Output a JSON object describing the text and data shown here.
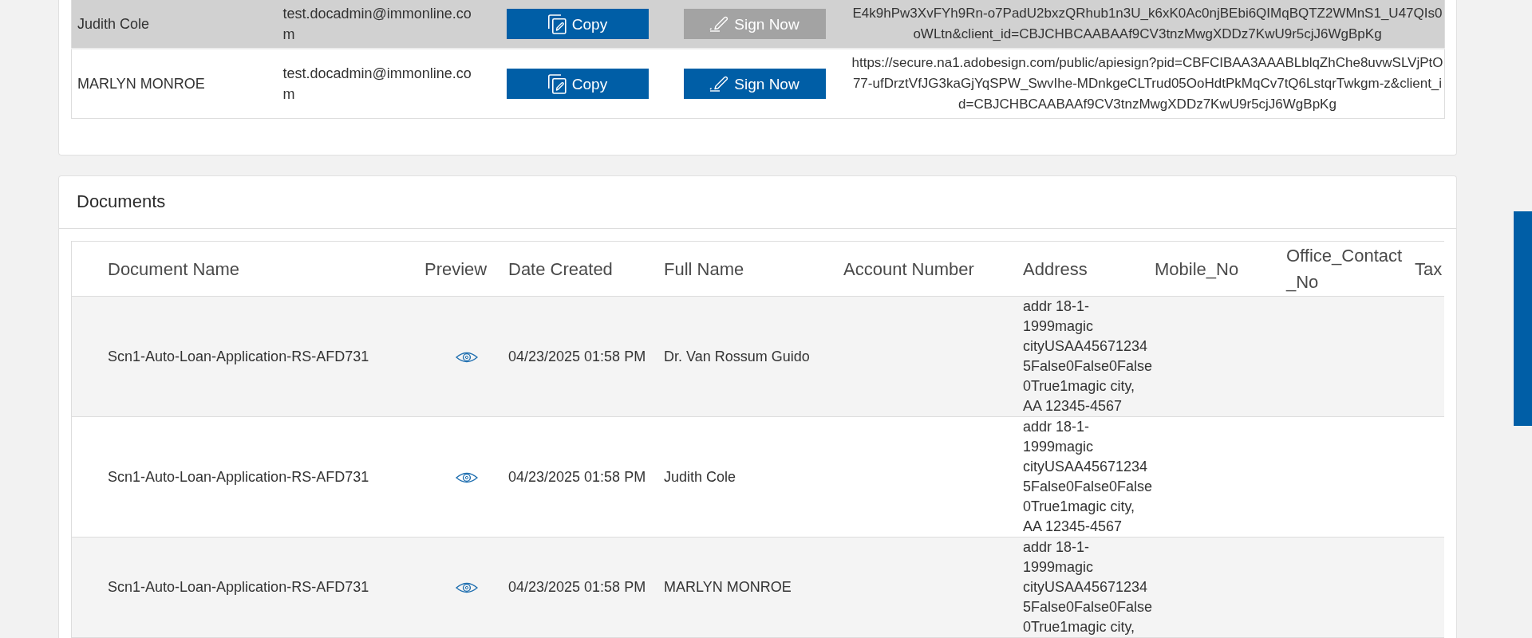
{
  "signers_table": {
    "rows": [
      {
        "name": "Judith Cole",
        "email": "test.docadmin@immonline.com",
        "highlighted": true,
        "copy_button": "Copy",
        "sign_button": {
          "label": "Sign Now",
          "disabled": true
        },
        "signing_url": "E4k9hPw3XvFYh9Rn-o7PadU2bxzQRhub1n3U_k6xK0Ac0njBEbi6QIMqBQTZ2WMnS1_U47QIs0oWLtn&client_id=CBJCHBCAABAAf9CV3tnzMwgXDDz7KwU9r5cjJ6WgBpKg"
      },
      {
        "name": "MARLYN MONROE",
        "email": "test.docadmin@immonline.com",
        "highlighted": false,
        "copy_button": "Copy",
        "sign_button": {
          "label": "Sign Now",
          "disabled": false
        },
        "signing_url": "https://secure.na1.adobesign.com/public/apiesign?pid=CBFCIBAA3AAABLblqZhChe8uvwSLVjPtO77-ufDrztVfJG3kaGjYqSPW_SwvIhe-MDnkgeCLTrud05OoHdtPkMqCv7tQ6LstqrTwkgm-z&client_id=CBJCHBCAABAAf9CV3tnzMwgXDDz7KwU9r5cjJ6WgBpKg"
      }
    ]
  },
  "documents": {
    "title": "Documents",
    "columns": [
      "Document Name",
      "Preview",
      "Date Created",
      "Full Name",
      "Account Number",
      "Address",
      "Mobile_No",
      "Office_Contact_No",
      "Tax"
    ],
    "rows": [
      {
        "document_name": "Scn1-Auto-Loan-Application-RS-AFD731",
        "date_created": "04/23/2025 01:58 PM",
        "full_name": "Dr. Van Rossum Guido",
        "address": "addr 18-1-1999magic cityUSAA456712345False0False0False0True1magic city, AA 12345-4567"
      },
      {
        "document_name": "Scn1-Auto-Loan-Application-RS-AFD731",
        "date_created": "04/23/2025 01:58 PM",
        "full_name": "Judith Cole",
        "address": "addr 18-1-1999magic cityUSAA456712345False0False0False0True1magic city, AA 12345-4567"
      },
      {
        "document_name": "Scn1-Auto-Loan-Application-RS-AFD731",
        "date_created": "04/23/2025 01:58 PM",
        "full_name": "MARLYN MONROE",
        "address": "addr 18-1-1999magic cityUSAA456712345False0False0False0True1magic city,"
      }
    ]
  }
}
